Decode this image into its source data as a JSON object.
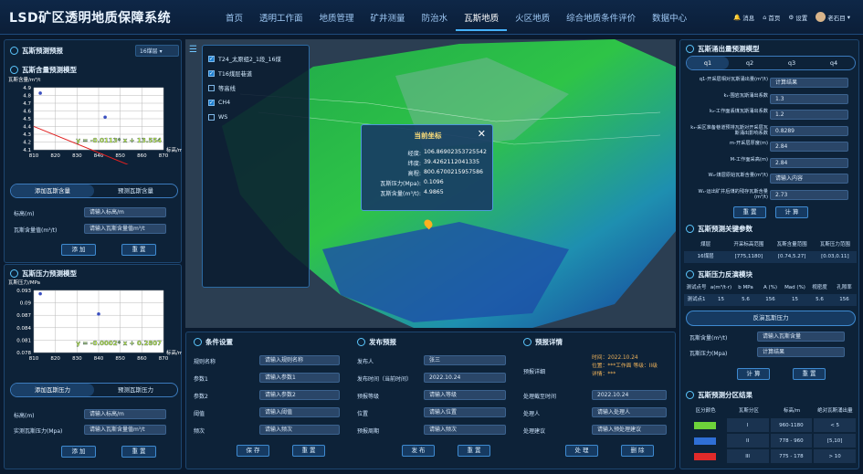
{
  "app": {
    "title": "LSD矿区透明地质保障系统",
    "nav": [
      "首页",
      "透明工作面",
      "地质管理",
      "矿井测量",
      "防治水",
      "瓦斯地质",
      "火区地质",
      "综合地质条件评价",
      "数据中心"
    ],
    "active_nav": 5,
    "top_right": {
      "msg": "消息",
      "home": "首页",
      "settings": "设置",
      "user": "老石目"
    }
  },
  "left": {
    "forecast_title": "瓦斯预测预报",
    "seam_select": "16煤层",
    "content_model_title": "瓦斯含量预测模型",
    "content_ylabel": "瓦斯含量/m³/t",
    "content_xlabel": "标高/m",
    "content_formula": "y = -0.0113* x + 13.554",
    "content_yticks": [
      "4.9",
      "4.8",
      "4.7",
      "4.6",
      "4.5",
      "4.4",
      "4.3",
      "4.2",
      "4.1"
    ],
    "content_xticks": [
      "810",
      "820",
      "830",
      "840",
      "850",
      "860",
      "870"
    ],
    "tabs1": [
      "添加瓦斯含量",
      "预测瓦斯含量"
    ],
    "form1": [
      {
        "label": "标高(m)",
        "placeholder": "请输入标高/m"
      },
      {
        "label": "瓦斯含量值(m³/t)",
        "placeholder": "请输入瓦斯含量值m³/t"
      }
    ],
    "add_label": "添 加",
    "reset_label": "重 置",
    "pressure_model_title": "瓦斯压力预测模型",
    "pressure_ylabel": "瓦斯压力/MPa",
    "pressure_xlabel": "标高/m",
    "pressure_formula": "y = -0.0002* x + 0.2807",
    "pressure_yticks": [
      "0.093",
      "0.09",
      "0.087",
      "0.084",
      "0.081",
      "0.078"
    ],
    "pressure_xticks": [
      "810",
      "820",
      "830",
      "840",
      "850",
      "860",
      "870"
    ],
    "tabs2": [
      "添加瓦斯压力",
      "预测瓦斯压力"
    ],
    "form2": [
      {
        "label": "标高(m)",
        "placeholder": "请输入标高/m"
      },
      {
        "label": "实测瓦斯压力(Mpa)",
        "placeholder": "请输入瓦斯含量值m³/t"
      }
    ]
  },
  "chart_data": [
    {
      "type": "scatter",
      "title": "瓦斯含量预测模型",
      "ylabel": "瓦斯含量/m³/t",
      "xlabel": "标高/m",
      "x": [
        813,
        843
      ],
      "y": [
        4.83,
        4.52
      ],
      "xlim": [
        810,
        870
      ],
      "ylim": [
        4.1,
        4.9
      ],
      "fit": {
        "slope": -0.0113,
        "intercept": 13.554
      }
    },
    {
      "type": "scatter",
      "title": "瓦斯压力预测模型",
      "ylabel": "瓦斯压力/MPa",
      "xlabel": "标高/m",
      "x": [
        813,
        840
      ],
      "y": [
        0.0922,
        0.0873
      ],
      "xlim": [
        810,
        870
      ],
      "ylim": [
        0.078,
        0.093
      ],
      "fit": {
        "slope": -0.0002,
        "intercept": 0.2807
      }
    }
  ],
  "layers": [
    {
      "label": "T24_太原组2_1段_16煤",
      "checked": true
    },
    {
      "label": "T16煤层巷道",
      "checked": true
    },
    {
      "label": "等高线",
      "checked": false
    },
    {
      "label": "CH4",
      "checked": true
    },
    {
      "label": "WS",
      "checked": false
    }
  ],
  "popup": {
    "title": "当前坐标",
    "rows": [
      {
        "k": "经度:",
        "v": "106.86902353725542"
      },
      {
        "k": "纬度:",
        "v": "39.4262112041335"
      },
      {
        "k": "高程:",
        "v": "800.6700215957586"
      },
      {
        "k": "瓦斯压力(Mpa):",
        "v": "0.1096"
      },
      {
        "k": "瓦斯含量(m³/t):",
        "v": "4.9865"
      }
    ]
  },
  "bottom": {
    "cond_title": "条件设置",
    "cond_rows": [
      {
        "label": "规则名称",
        "value": "请输入规则名称"
      },
      {
        "label": "参数1",
        "value": "请输入参数1"
      },
      {
        "label": "参数2",
        "value": "请输入参数2"
      },
      {
        "label": "阈值",
        "value": "请输入阈值"
      },
      {
        "label": "频次",
        "value": "请输入频次"
      }
    ],
    "save_label": "保 存",
    "reset_label": "重 置",
    "pub_title": "发布预报",
    "pub_rows": [
      {
        "label": "发布人",
        "value": "张三"
      },
      {
        "label": "发布时间（当前时间）",
        "value": "2022.10.24"
      },
      {
        "label": "预报等级",
        "value": "请输入等级"
      },
      {
        "label": "位置",
        "value": "请输入位置"
      },
      {
        "label": "预报周期",
        "value": "请输入频次"
      }
    ],
    "publish_label": "发 布",
    "detail_title": "预报详情",
    "detail_label": "预报详细",
    "detail_text": [
      "时间：2022.10.24",
      "位置：***工作面 等级：II级",
      "详情：***"
    ],
    "detail_rows": [
      {
        "label": "处理截至时间",
        "value": "2022.10.24"
      },
      {
        "label": "处理人",
        "value": "请输入处理人"
      },
      {
        "label": "处理建议",
        "value": "请输入预处理建议"
      }
    ],
    "process_label": "处 理",
    "delete_label": "删 除"
  },
  "right": {
    "emission_title": "瓦斯涌出量预测模型",
    "q_tabs": [
      "q1",
      "q2",
      "q3",
      "q4"
    ],
    "q_rows": [
      {
        "label": "q1-开采层相对瓦斯涌出量(m³/t)",
        "value": "计算结果"
      },
      {
        "label": "k₁-围岩瓦斯涌出系数",
        "value": "1.3"
      },
      {
        "label": "k₂-工作面丢煤瓦斯涌出系数",
        "value": "1.2"
      },
      {
        "label": "k₃-采区准备巷道预排瓦斯对开采层瓦斯涌出影响系数",
        "value": "0.8289"
      },
      {
        "label": "m-开采层厚度(m)",
        "value": "2.84"
      },
      {
        "label": "M-工作面采高(m)",
        "value": "2.84"
      },
      {
        "label": "W₀-煤层原始瓦斯含量(m³/t)",
        "value": "请输入内容"
      },
      {
        "label": "W₁-运出矿井后煤的残存瓦斯含量(m³/t)",
        "value": "2.73"
      }
    ],
    "reset_label": "重 置",
    "calc_label": "计 算",
    "key_title": "瓦斯预测关键参数",
    "key_headers": [
      "煤层",
      "开采标高范围",
      "瓦斯含量范围",
      "瓦斯压力范围"
    ],
    "key_row": [
      "16煤层",
      "[775,1180]",
      "[0.74,5.27]",
      "[0.03,0.11]"
    ],
    "reverse_title": "瓦斯压力反演模块",
    "rev_headers": [
      "测试点号",
      "a(m³/t·r)",
      "b MPa",
      "A (%)",
      "Mad (%)",
      "视密度",
      "孔隙率"
    ],
    "rev_row": [
      "测试点1",
      "15",
      "5.6",
      "156",
      "15",
      "5.6",
      "156"
    ],
    "reverse_btn": "反演瓦斯压力",
    "rev_form": [
      {
        "label": "瓦斯含量(m³/t)",
        "value": "请输入瓦斯含量"
      },
      {
        "label": "瓦斯压力(Mpa)",
        "value": "计算结果"
      }
    ],
    "zone_title": "瓦斯预测分区结果",
    "zone_headers": [
      "区分颜色",
      "瓦斯分区",
      "标高/m",
      "绝对瓦斯涌出量"
    ],
    "zones": [
      {
        "color": "#6dd33a",
        "zone": "I",
        "elev": "960-1180",
        "amount": "< 5"
      },
      {
        "color": "#2f6fd6",
        "zone": "II",
        "elev": "778 - 960",
        "amount": "[5,10]"
      },
      {
        "color": "#e02a2a",
        "zone": "III",
        "elev": "775 - 178",
        "amount": "> 10"
      }
    ]
  }
}
